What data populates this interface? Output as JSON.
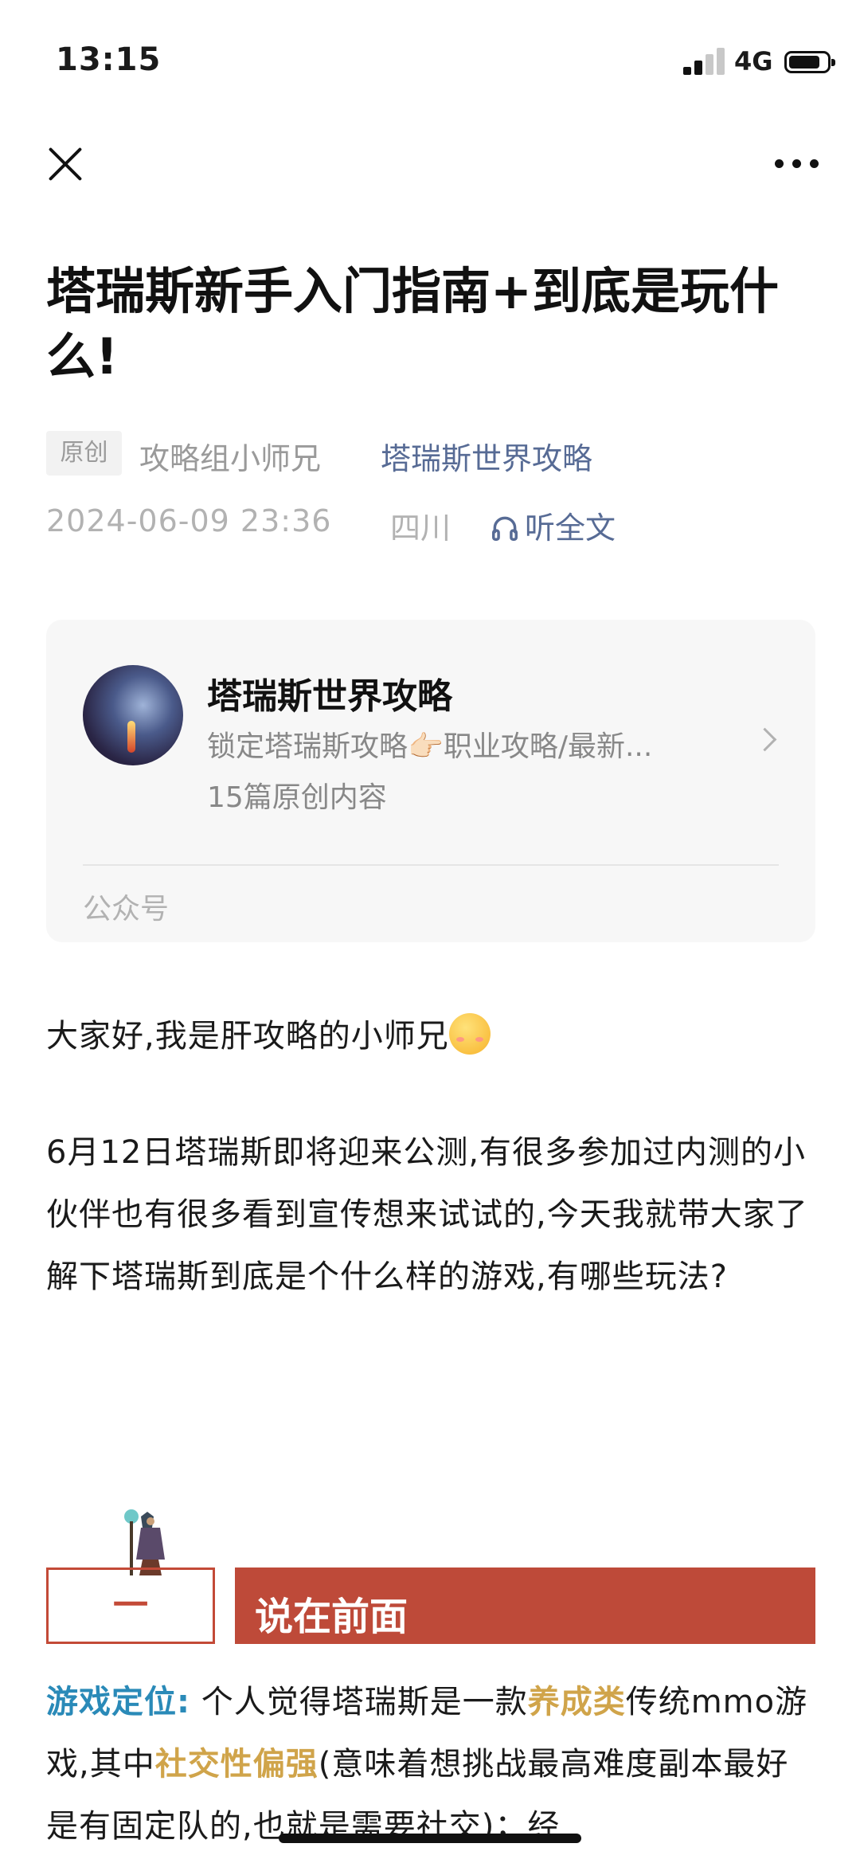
{
  "status_bar": {
    "time": "13:15",
    "network": "4G"
  },
  "article": {
    "title": "塔瑞斯新手入门指南+到底是玩什么!",
    "tag": "原创",
    "author": "攻略组小师兄",
    "account_name": "塔瑞斯世界攻略",
    "date": "2024-06-09 23:36",
    "location": "四川",
    "listen_label": "听全文"
  },
  "account_card": {
    "name": "塔瑞斯世界攻略",
    "description": "锁定塔瑞斯攻略👉🏻职业攻略/最新...",
    "count": "15篇原创内容",
    "type": "公众号"
  },
  "body": {
    "greeting": "大家好,我是肝攻略的小师兄",
    "intro": "6月12日塔瑞斯即将迎来公测,有很多参加过内测的小伙伴也有很多看到宣传想来试试的,今天我就带大家了解下塔瑞斯到底是个什么样的游戏,有哪些玩法?",
    "section": {
      "number": "一",
      "title": "说在前面"
    },
    "p1_label": "游戏定位:",
    "p1_a": " 个人觉得塔瑞斯是一款",
    "p1_hl1": "养成类",
    "p1_b": "传统mmo游戏,其中",
    "p1_hl2": "社交性偏强",
    "p1_c": "(意味着想挑战最高难度副本最好是有固定队的,也就是需要社交)；经"
  },
  "colors": {
    "link": "#576b95",
    "accent_red": "#be4a39",
    "highlight_blue": "#2a8ab8",
    "highlight_gold": "#d0a44a"
  }
}
